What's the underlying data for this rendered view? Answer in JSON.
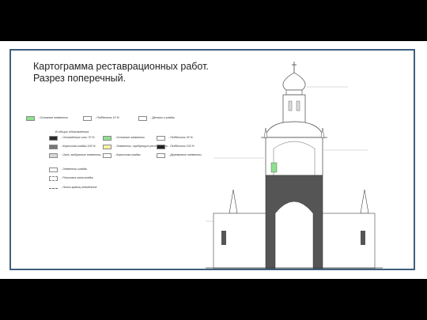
{
  "slide": {
    "title_line1": "Картограмма реставрационных работ.",
    "title_line2": "Разрез поперечный."
  },
  "legend": {
    "top_row": [
      {
        "label": "- Основные элементы",
        "color": "#8fe08f"
      },
      {
        "label": "- Подбелить 10 %",
        "color": "#ffffff"
      },
      {
        "label": "- Детали и кладки",
        "color": "#ffffff"
      }
    ],
    "subheading": "В общих обозначениях",
    "grid": [
      {
        "label": "- Отпалённые слои 70 %",
        "color": "#2a2a2a"
      },
      {
        "label": "- Основные элементы",
        "color": "#8fe08f"
      },
      {
        "label": "- Подбелить 30 %",
        "color": "#ffffff"
      },
      {
        "label": "- Кирпичная кладка 100 %",
        "color": "#777777"
      },
      {
        "label": "- Элементы, требующие реставрации",
        "color": "#fbf3a6"
      },
      {
        "label": "- Подбелить 100 %",
        "color": "#222222"
      },
      {
        "label": "- Окно, выбранные элементы",
        "color": "#d8d8d8"
      },
      {
        "label": "- Кирпичная кладка",
        "color": "#ffffff"
      },
      {
        "label": "- Деревянные элементы",
        "color": "#ffffff"
      }
    ],
    "bottom": [
      {
        "label": "- Элементы кладки",
        "color": "#ffffff"
      },
      {
        "label": "- Расшивка швов кладки",
        "color": "#ffffff"
      },
      {
        "label": "- Линии границ элементов",
        "color": "#ffffff"
      }
    ]
  },
  "colors": {
    "frame": "#3f5f7f",
    "masonry": "#555555",
    "green": "#8fe08f",
    "outline": "#444444"
  }
}
